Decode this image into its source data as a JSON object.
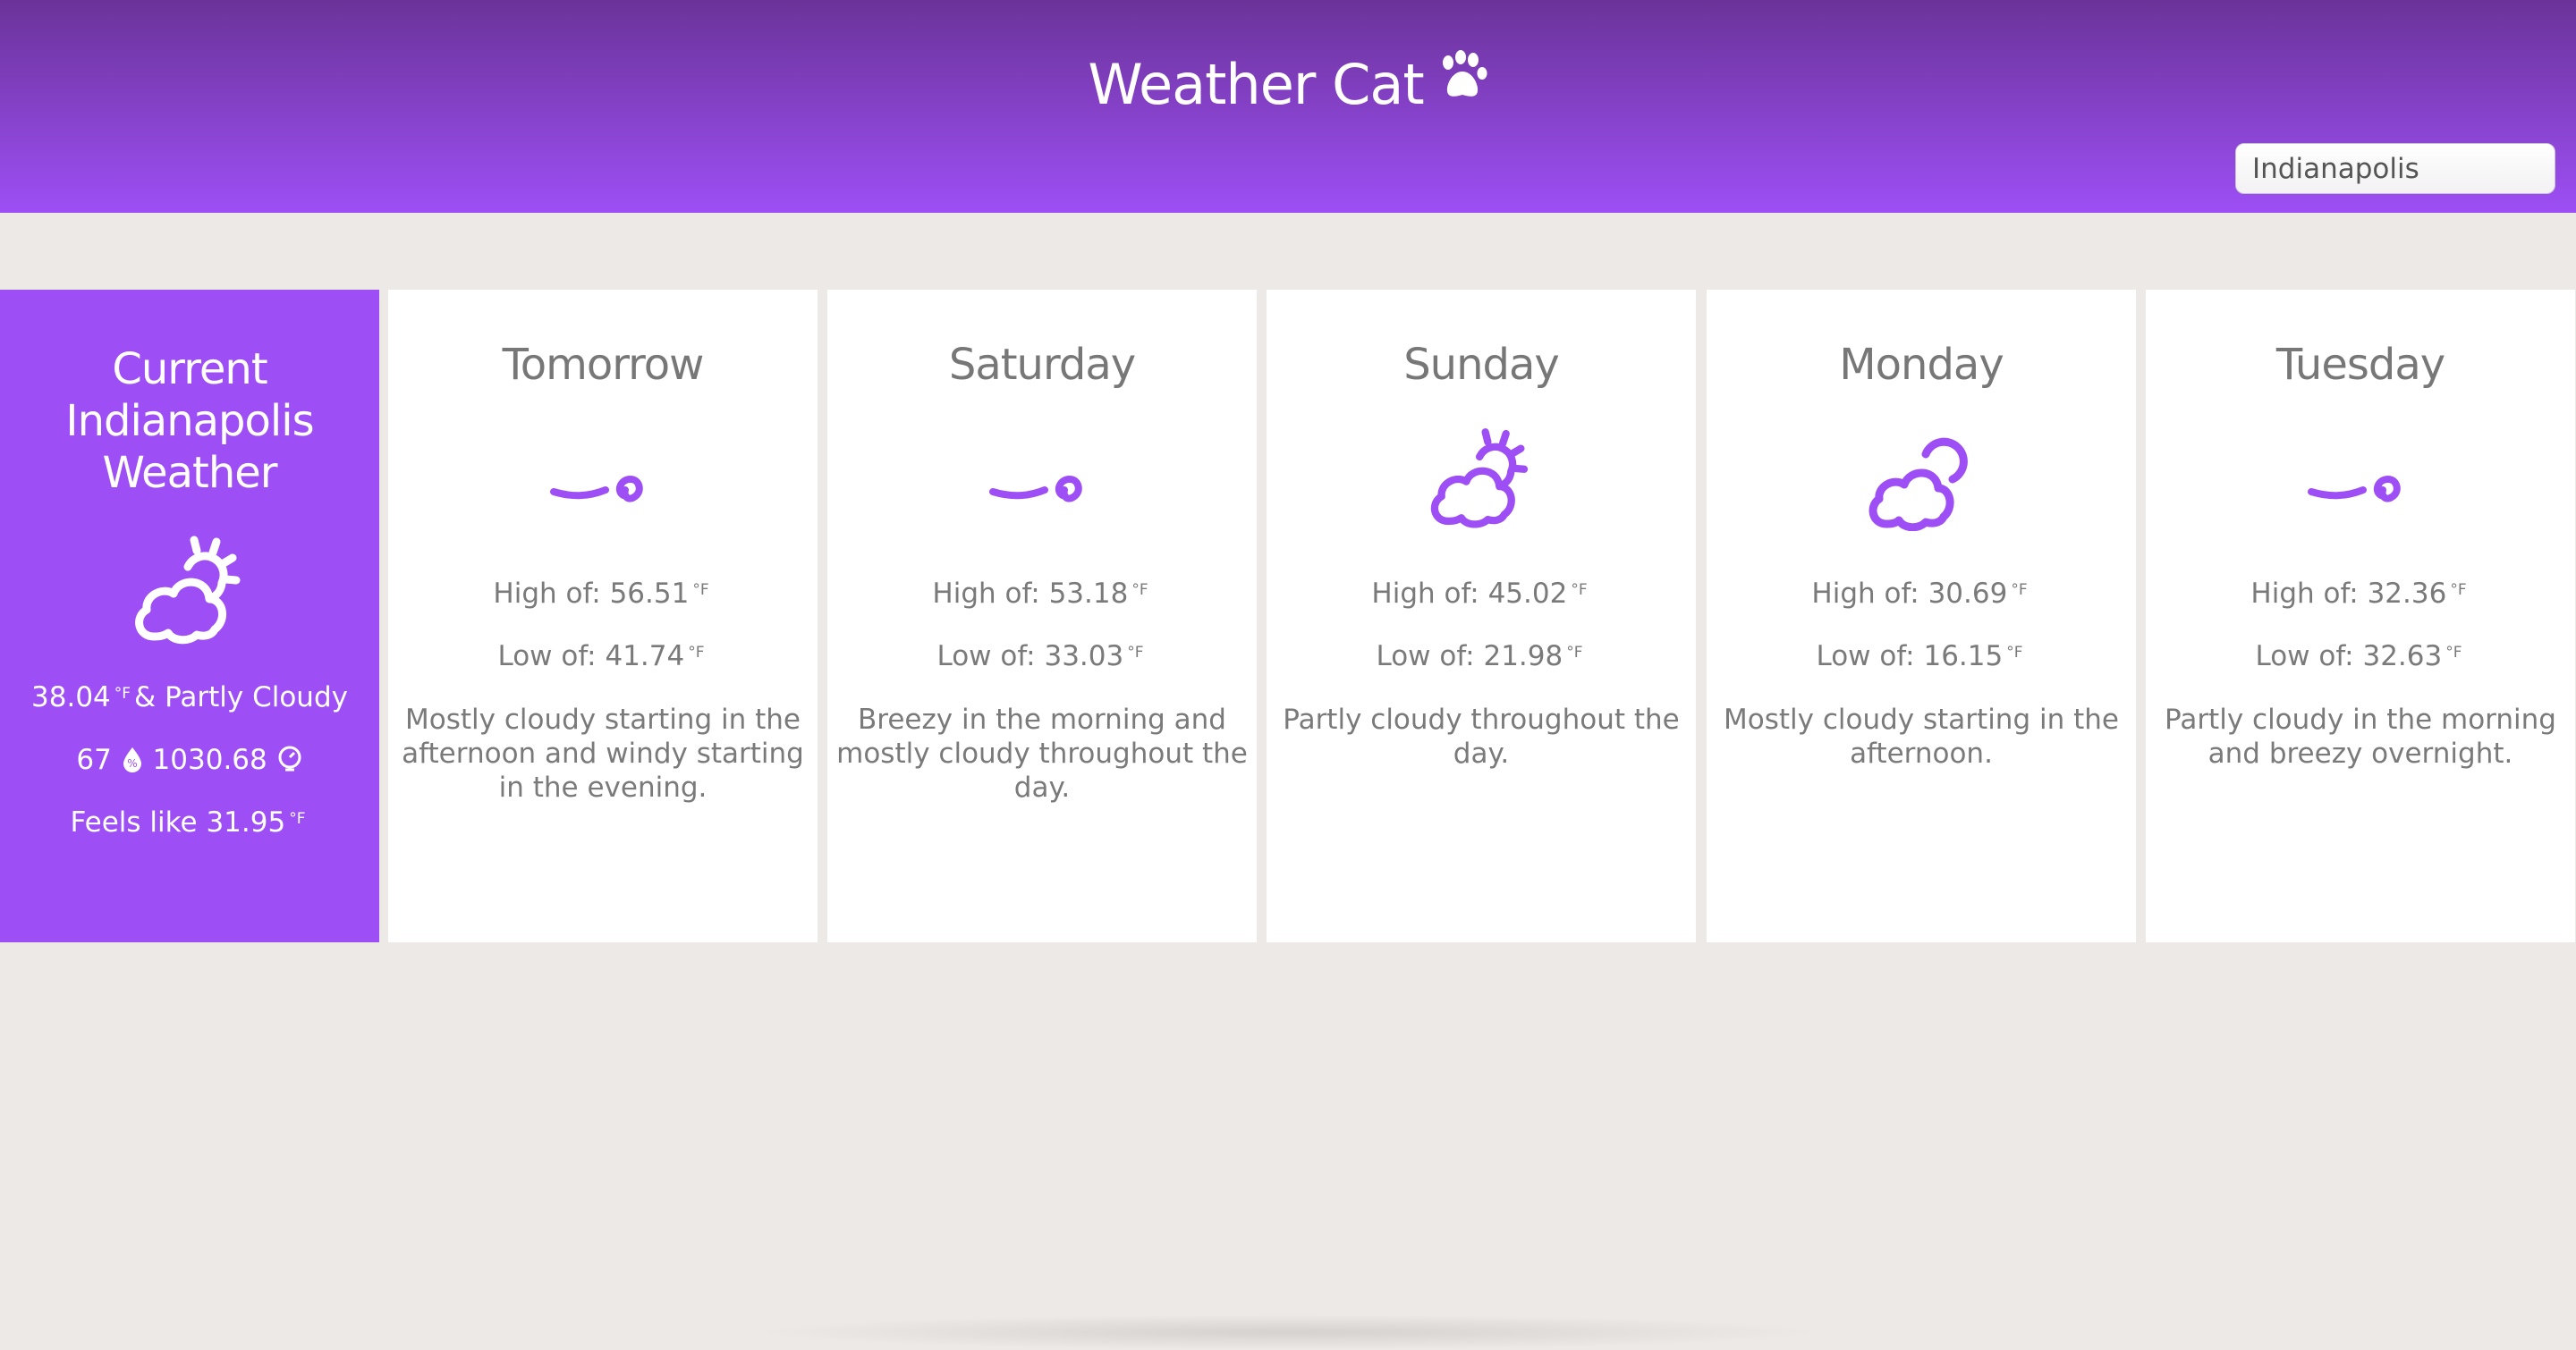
{
  "header": {
    "title": "Weather Cat",
    "search_value": "Indianapolis"
  },
  "current": {
    "title": "Current Indianapolis Weather",
    "icon": "partly-cloudy-day-icon",
    "temp": "38.04",
    "unit": "°F",
    "condition": "& Partly Cloudy",
    "humidity": "67",
    "pressure": "1030.68",
    "feels_label": "Feels like",
    "feels": "31.95"
  },
  "forecast": [
    {
      "day": "Tomorrow",
      "icon": "wind-icon",
      "high_label": "High of:",
      "high": "56.51",
      "low_label": "Low of:",
      "low": "41.74",
      "unit": "°F",
      "summary": "Mostly cloudy starting in the afternoon and windy starting in the evening."
    },
    {
      "day": "Saturday",
      "icon": "wind-icon",
      "high_label": "High of:",
      "high": "53.18",
      "low_label": "Low of:",
      "low": "33.03",
      "unit": "°F",
      "summary": "Breezy in the morning and mostly cloudy throughout the day."
    },
    {
      "day": "Sunday",
      "icon": "partly-cloudy-day-icon",
      "high_label": "High of:",
      "high": "45.02",
      "low_label": "Low of:",
      "low": "21.98",
      "unit": "°F",
      "summary": "Partly cloudy throughout the day."
    },
    {
      "day": "Monday",
      "icon": "partly-cloudy-night-icon",
      "high_label": "High of:",
      "high": "30.69",
      "low_label": "Low of:",
      "low": "16.15",
      "unit": "°F",
      "summary": "Mostly cloudy starting in the afternoon."
    },
    {
      "day": "Tuesday",
      "icon": "wind-icon",
      "high_label": "High of:",
      "high": "32.36",
      "low_label": "Low of:",
      "low": "32.63",
      "unit": "°F",
      "summary": "Partly cloudy in the morning and breezy overnight."
    }
  ],
  "colors": {
    "accent": "#9d4ff5",
    "header_top": "#6b3399",
    "background": "#ede9e6",
    "card": "#ffffff",
    "text_muted": "#7a7a7a"
  }
}
